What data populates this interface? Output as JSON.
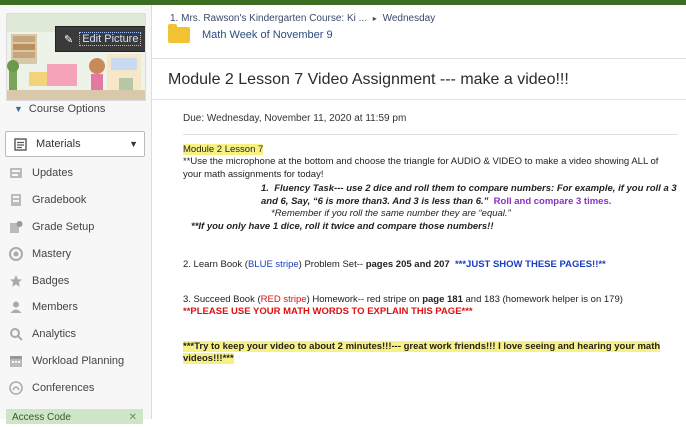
{
  "sidebar": {
    "edit_picture_label": "Edit Picture",
    "course_options_label": "Course Options",
    "materials_label": "Materials",
    "items": [
      {
        "label": "Updates",
        "icon": "updates-icon"
      },
      {
        "label": "Gradebook",
        "icon": "gradebook-icon"
      },
      {
        "label": "Grade Setup",
        "icon": "grade-setup-icon"
      },
      {
        "label": "Mastery",
        "icon": "mastery-icon"
      },
      {
        "label": "Badges",
        "icon": "badge-icon"
      },
      {
        "label": "Members",
        "icon": "members-icon"
      },
      {
        "label": "Analytics",
        "icon": "analytics-icon"
      },
      {
        "label": "Workload Planning",
        "icon": "workload-icon"
      },
      {
        "label": "Conferences",
        "icon": "conferences-icon"
      }
    ],
    "access_code_label": "Access Code"
  },
  "breadcrumb": {
    "course": "1. Mrs. Rawson's Kindergarten Course: Ki ...",
    "separator": "▸",
    "current": "Wednesday"
  },
  "folder": {
    "title": "Math Week of November 9"
  },
  "assignment": {
    "title": "Module 2 Lesson 7 Video Assignment --- make a video!!!",
    "due": "Due: Wednesday, November 11, 2020 at 11:59 pm",
    "heading": "Module 2 Lesson 7",
    "intro": "**Use the microphone at the bottom and choose the triangle for AUDIO & VIDEO to make a video showing ALL of your math assignments for today!",
    "fluency_num": "1.",
    "fluency_text": "Fluency Task--- use 2 dice and roll them to compare numbers: For example, if you roll a 3 and 6, Say, “6 is more than3. And 3 is less than 6.”",
    "fluency_purple": "Roll and compare 3 times.",
    "remember": "*Remember if you roll the same number they are “equal.”",
    "one_die": "**If you only have 1 dice, roll it twice and compare those numbers!!",
    "learn_a": "2. Learn Book (",
    "learn_blue": "BLUE stripe",
    "learn_b": ") Problem Set-- ",
    "learn_pages": "pages 205 and 207",
    "learn_note": "***JUST SHOW THESE PAGES!!**",
    "succeed_a": "3. Succeed Book (",
    "succeed_red": "RED stripe",
    "succeed_b": ") Homework-- red stripe on ",
    "succeed_page1": "page 181",
    "succeed_c": " and 183 (homework helper is on 179)",
    "succeed_note": "**PLEASE USE YOUR MATH WORDS TO EXPLAIN THIS PAGE***",
    "closing": "***Try to keep your video to about 2 minutes!!!--- great work friends!!!  I love seeing and hearing your math videos!!!***"
  }
}
